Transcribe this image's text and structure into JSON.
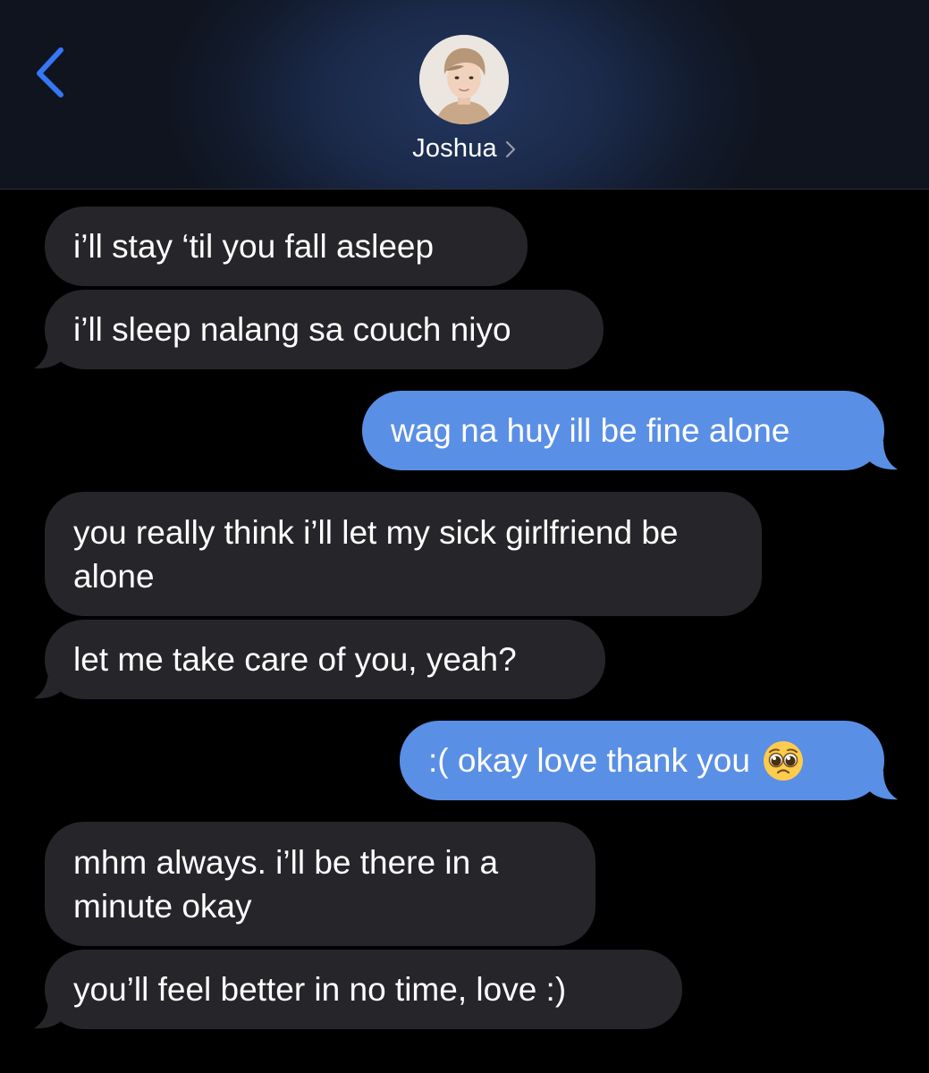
{
  "header": {
    "contact_name": "Joshua",
    "back_icon": "chevron-left-icon",
    "details_icon": "chevron-right-icon",
    "accent_color": "#3478f6"
  },
  "messages": [
    {
      "sender": "them",
      "text": "i’ll stay ‘til you fall asleep"
    },
    {
      "sender": "them",
      "text": "i’ll sleep nalang sa couch niyo"
    },
    {
      "sender": "me",
      "text": "wag na huy ill be fine alone"
    },
    {
      "sender": "them",
      "text": "you really think i’ll let my sick girlfriend be alone"
    },
    {
      "sender": "them",
      "text": "let me take care of you, yeah?"
    },
    {
      "sender": "me",
      "text": ":( okay love thank you",
      "emoji": "pleading-face-emoji"
    },
    {
      "sender": "them",
      "text": "mhm always. i’ll be there in a minute okay"
    },
    {
      "sender": "them",
      "text": "you’ll feel better in no time, love :)"
    }
  ],
  "colors": {
    "incoming_bubble": "#26262a",
    "outgoing_bubble": "#5a8fe6",
    "background": "#000000"
  }
}
